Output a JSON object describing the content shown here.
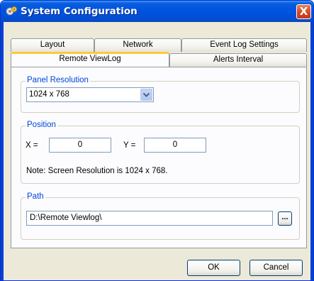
{
  "window": {
    "title": "System Configuration",
    "close_label": "X"
  },
  "tabs": {
    "row_back": [
      {
        "label": "Layout"
      },
      {
        "label": "Network"
      },
      {
        "label": "Event Log Settings"
      }
    ],
    "row_front": [
      {
        "label": "Remote ViewLog",
        "active": true
      },
      {
        "label": "Alerts Interval",
        "active": false
      }
    ]
  },
  "panel_resolution": {
    "legend": "Panel Resolution",
    "selected": "1024 x 768"
  },
  "position": {
    "legend": "Position",
    "x_label": "X =",
    "x_value": "0",
    "y_label": "Y =",
    "y_value": "0",
    "note": "Note: Screen Resolution is 1024 x 768."
  },
  "path": {
    "legend": "Path",
    "value": "D:\\Remote Viewlog\\",
    "browse_label": "..."
  },
  "buttons": {
    "ok": "OK",
    "cancel": "Cancel"
  },
  "colors": {
    "title_bar": "#0054e3",
    "legend_text": "#0046d5",
    "active_tab_accent": "#ffc83c",
    "close_button": "#d24a22"
  }
}
